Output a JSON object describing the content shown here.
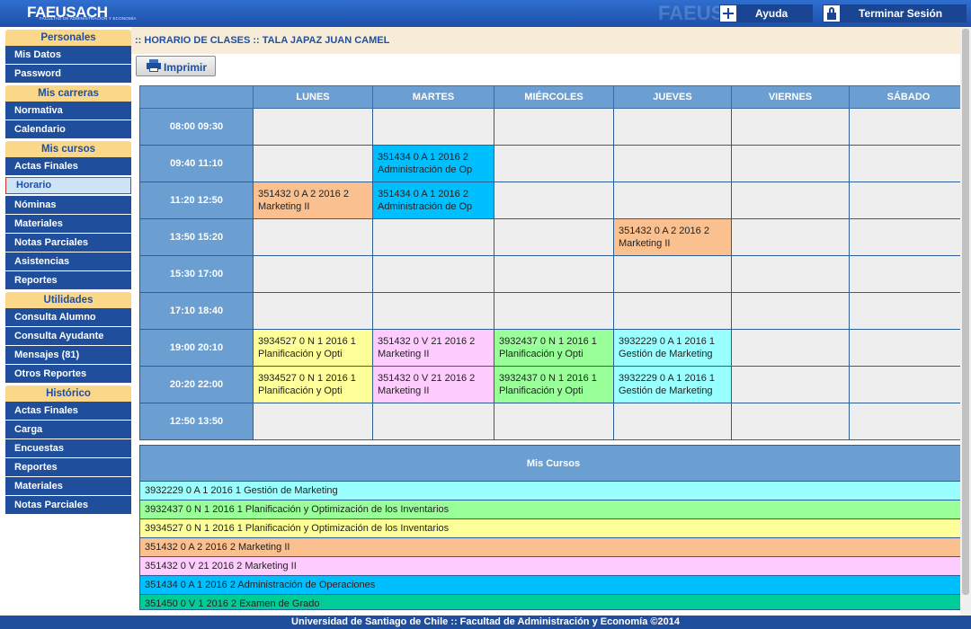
{
  "header": {
    "logo": "FAEUSACH",
    "logo_sub": "FACULTAD DE ADMINISTRACIÓN Y ECONOMÍA",
    "help_label": "Ayuda",
    "logout_label": "Terminar Sesión"
  },
  "sidebar": {
    "sections": [
      {
        "title": "Personales",
        "items": [
          "Mis Datos",
          "Password"
        ]
      },
      {
        "title": "Mis carreras",
        "items": [
          "Normativa",
          "Calendario"
        ]
      },
      {
        "title": "Mis cursos",
        "items": [
          "Actas Finales",
          "Horario",
          "Nóminas",
          "Materiales",
          "Notas Parciales",
          "Asistencias",
          "Reportes"
        ]
      },
      {
        "title": "Utilidades",
        "items": [
          "Consulta Alumno",
          "Consulta Ayudante",
          "Mensajes (81)",
          "Otros Reportes"
        ]
      },
      {
        "title": "Histórico",
        "items": [
          "Actas Finales",
          "Carga",
          "Encuestas",
          "Reportes",
          "Materiales",
          "Notas Parciales"
        ]
      }
    ],
    "active_item": "Horario"
  },
  "breadcrumb": ":: HORARIO DE CLASES :: TALA JAPAZ JUAN CAMEL",
  "toolbar": {
    "print_label": "Imprimir"
  },
  "schedule": {
    "days": [
      "LUNES",
      "MARTES",
      "MIÉRCOLES",
      "JUEVES",
      "VIERNES",
      "SÁBADO"
    ],
    "rows": [
      {
        "time": "08:00 09:30",
        "cells": [
          null,
          null,
          null,
          null,
          null,
          null
        ]
      },
      {
        "time": "09:40 11:10",
        "cells": [
          null,
          {
            "line1": "351434 0 A 1 2016 2",
            "line2": "Administración de Op",
            "color": "#00bfff"
          },
          null,
          null,
          null,
          null
        ]
      },
      {
        "time": "11:20 12:50",
        "cells": [
          {
            "line1": "351432 0 A 2 2016 2",
            "line2": "Marketing II",
            "color": "#fac08f"
          },
          {
            "line1": "351434 0 A 1 2016 2",
            "line2": "Administración de Op",
            "color": "#00bfff"
          },
          null,
          null,
          null,
          null
        ]
      },
      {
        "time": "13:50 15:20",
        "cells": [
          null,
          null,
          null,
          {
            "line1": "351432 0 A 2 2016 2",
            "line2": "Marketing II",
            "color": "#fac08f"
          },
          null,
          null
        ]
      },
      {
        "time": "15:30 17:00",
        "cells": [
          null,
          null,
          null,
          null,
          null,
          null
        ]
      },
      {
        "time": "17:10 18:40",
        "cells": [
          null,
          null,
          null,
          null,
          null,
          null
        ]
      },
      {
        "time": "19:00 20:10",
        "cells": [
          {
            "line1": "3934527 0 N 1 2016 1",
            "line2": "Planificación y Opti",
            "color": "#ffff99"
          },
          {
            "line1": "351432 0 V 21 2016 2",
            "line2": "Marketing II",
            "color": "#ffccff"
          },
          {
            "line1": "3932437 0 N 1 2016 1",
            "line2": "Planificación y Opti",
            "color": "#99ff99"
          },
          {
            "line1": "3932229 0 A 1 2016 1",
            "line2": "Gestión de Marketing",
            "color": "#99ffff"
          },
          null,
          null
        ]
      },
      {
        "time": "20:20 22:00",
        "cells": [
          {
            "line1": "3934527 0 N 1 2016 1",
            "line2": "Planificación y Opti",
            "color": "#ffff99"
          },
          {
            "line1": "351432 0 V 21 2016 2",
            "line2": "Marketing II",
            "color": "#ffccff"
          },
          {
            "line1": "3932437 0 N 1 2016 1",
            "line2": "Planificación y Opti",
            "color": "#99ff99"
          },
          {
            "line1": "3932229 0 A 1 2016 1",
            "line2": "Gestión de Marketing",
            "color": "#99ffff"
          },
          null,
          null
        ]
      },
      {
        "time": "12:50 13:50",
        "cells": [
          null,
          null,
          null,
          null,
          null,
          null
        ]
      }
    ]
  },
  "courses": {
    "title": "Mis Cursos",
    "items": [
      {
        "text": "3932229 0 A 1 2016 1 Gestión de Marketing",
        "color": "#99ffff"
      },
      {
        "text": "3932437 0 N 1 2016 1 Planificación y Optimización de los Inventarios",
        "color": "#99ff99"
      },
      {
        "text": "3934527 0 N 1 2016 1 Planificación y Optimización de los Inventarios",
        "color": "#ffff99"
      },
      {
        "text": "351432 0 A 2 2016 2 Marketing II",
        "color": "#fac08f"
      },
      {
        "text": "351432 0 V 21 2016 2 Marketing II",
        "color": "#ffccff"
      },
      {
        "text": "351434 0 A 1 2016 2 Administración de Operaciones",
        "color": "#00bfff"
      },
      {
        "text": "351450 0 V 1 2016 2 Examen de Grado",
        "color": "#00cc99"
      }
    ]
  },
  "footer": "Universidad de Santiago de Chile :: Facultad de Administración y Economía ©2014"
}
